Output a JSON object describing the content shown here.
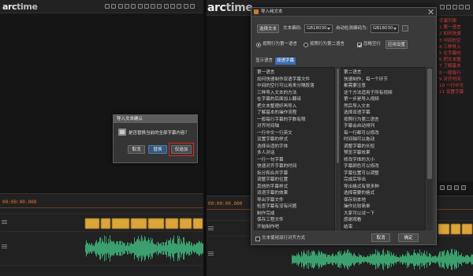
{
  "left_window": {
    "logo": {
      "part1": "arc",
      "part2": "time"
    },
    "timecode": "00:00:00.000",
    "confirm_dialog": {
      "title": "导入文本确认",
      "message": "是否替换当前的全部字幕内容？",
      "cancel_label": "取消",
      "replace_label": "替换",
      "append_label": "仅追加"
    }
  },
  "right_window": {
    "logo": {
      "part1": "arc",
      "part2": "time"
    },
    "timecode": "00:00:00.000",
    "subtitle_list_lines": [
      "字幕列表",
      "1 第一语言",
      "2 如何快速",
      "3 中间的空",
      "4 三种导入",
      "5 在字幕的",
      "6 把文本整",
      "7 了解基本",
      "8 一般每行",
      "9 对齐时间",
      "10 一行中文",
      "11 设置字幕"
    ],
    "import_dialog": {
      "title": "导入纯文本",
      "choose_file_label": "选择文本",
      "encoding_label": "文本编码:",
      "encoding_value": "GB18030",
      "detected_label": "自动检测编码为:",
      "detected_value": "GB18030",
      "option_first_language": "按照行为第一语言",
      "option_second_language": "按照行为第二语言",
      "option_skip_blank": "忽略空行",
      "apply_label": "应用设置",
      "display_label": "显示语言",
      "display_value": "双语字幕",
      "first_language_lines": [
        "第一语言",
        "如何快速制作双语字幕文件",
        "中间的空行可以用来分隔段落",
        "三种导入文本的方法",
        "在字幕的后面加上翻译",
        "把文本整理好再导入",
        "了解基本的操作流程",
        "一般每行字幕的字数有限",
        "对齐时间轴",
        "一行中文一行英文",
        "设置字幕的样式",
        "选择合适的字体",
        "多人对话",
        "一行一句字幕",
        "快速对齐字幕的时间",
        "拆分和合并字幕",
        "调整字幕的位置",
        "其他的字幕样式",
        "双语字幕的效果",
        "导出字幕文件",
        "检查字幕有没有问题",
        "制作完成",
        "保存工程文件",
        "开始制作吧"
      ],
      "second_language_lines": [
        "第二语言",
        "快速制作，每一个环节",
        "都需要注意",
        "这个方法适用于所有视频",
        "第一步是导入视频",
        "然后导入文本",
        "选择双语字幕",
        "按照行为第二语言",
        "字幕会自动排列",
        "每一行都可以修改",
        "时间轴可以拖动",
        "调整字幕的长短",
        "预览字幕效果",
        "修改字体的大小",
        "字幕颜色可以修改",
        "字幕位置可以调整",
        "完成后导出",
        "导出格式有很多种",
        "选择需要的格式",
        "保存到本地",
        "操作比较简单",
        "大家可以试一下",
        "感谢观看",
        "结束"
      ],
      "align_checkbox_label": "文本使用双行对齐方式",
      "cancel_label": "取消",
      "ok_label": "确定"
    }
  },
  "colors": {
    "timecode": "#e0782e",
    "subtitle_block": "#dba53a",
    "subtitle_block_border": "#8b6422",
    "waveform": "#3fae78",
    "red_text": "#d63a3a",
    "highlight_blue": "#3b6fb0",
    "annotation_red": "#e02424"
  }
}
